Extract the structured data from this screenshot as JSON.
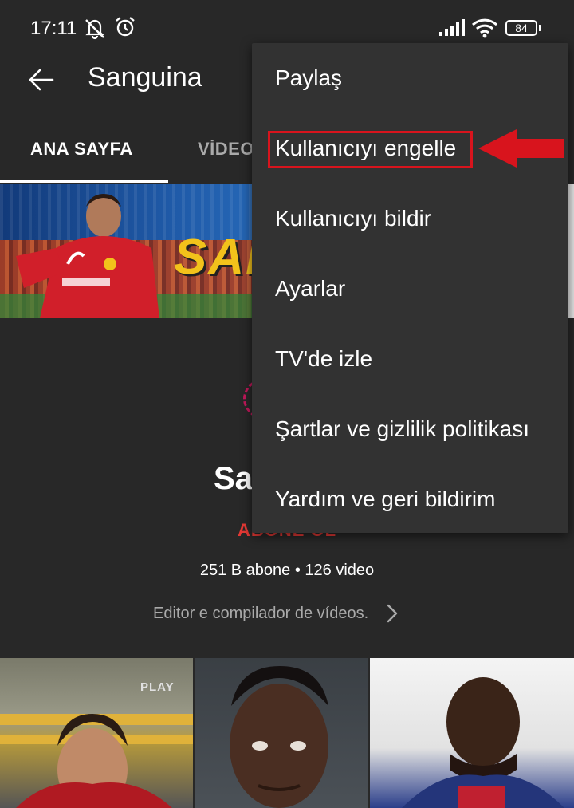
{
  "status_bar": {
    "time": "17:11",
    "battery": "84",
    "icons": [
      "bell-off-icon",
      "alarm-icon",
      "signal-icon",
      "wifi-icon",
      "battery-icon"
    ]
  },
  "app_bar": {
    "back_icon": "arrow-left-icon",
    "title": "Sanguina"
  },
  "tabs": [
    {
      "label": "ANA SAYFA",
      "active": true
    },
    {
      "label": "VİDEO",
      "active": false
    }
  ],
  "banner": {
    "logo_text": "SAN"
  },
  "channel": {
    "name": "Sa",
    "subscribe_label": "ABONE OL",
    "stats": "251 B abone • 126 video",
    "description": "Editor e compilador de vídeos."
  },
  "thumbnails": [
    {
      "overlay_text": "PLAY"
    },
    {},
    {}
  ],
  "overflow_menu": {
    "items": [
      {
        "label": "Paylaş"
      },
      {
        "label": "Kullanıcıyı engelle",
        "highlighted": true
      },
      {
        "label": "Kullanıcıyı bildir"
      },
      {
        "label": "Ayarlar"
      },
      {
        "label": "TV'de izle"
      },
      {
        "label": "Şartlar ve gizlilik politikası"
      },
      {
        "label": "Yardım ve geri bildirim"
      }
    ]
  },
  "colors": {
    "background": "#282828",
    "menu_background": "#323232",
    "annotation_red": "#d8141d",
    "subscribe_red": "#e53935",
    "secondary_text": "#aaaaaa"
  }
}
